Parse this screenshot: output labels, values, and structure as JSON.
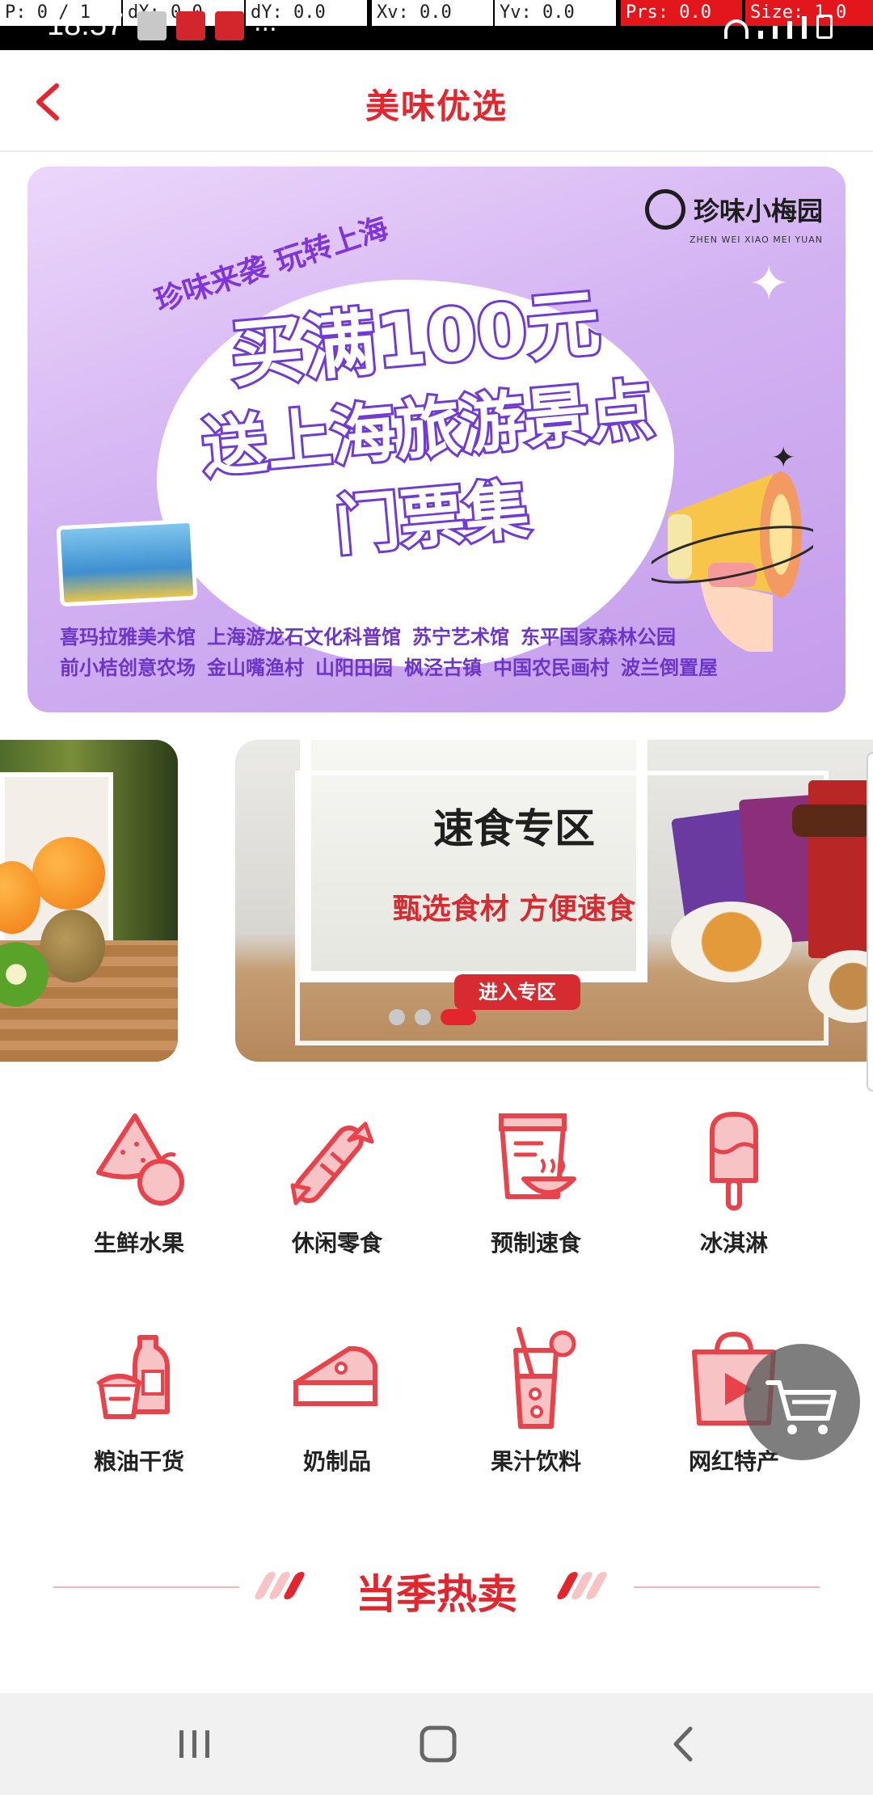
{
  "debug_bar": {
    "p": "P: 0 / 1",
    "dx": "dX: 0.0",
    "dy": "dY: 0.0",
    "xv": "Xv: 0.0",
    "yv": "Yv: 0.0",
    "prs": "Prs: 0.0",
    "size": "Size: 1.0"
  },
  "status_bar": {
    "time": "18:57",
    "overflow": "..."
  },
  "header": {
    "title": "美味优选",
    "back_icon": "chevron-left-icon"
  },
  "banner": {
    "tagline": "珍味来袭 玩转上海",
    "headline1": "买满100元",
    "headline2": "送上海旅游景点",
    "headline3": "门票集",
    "brand": "珍味小梅园",
    "brand_en": "ZHEN WEI XIAO MEI YUAN",
    "venues_row1": [
      "喜玛拉雅美术馆",
      "上海游龙石文化科普馆",
      "苏宁艺术馆",
      "东平国家森林公园"
    ],
    "venues_row2": [
      "前小桔创意农场",
      "金山嘴渔村",
      "山阳田园",
      "枫泾古镇",
      "中国农民画村",
      "波兰倒置屋"
    ]
  },
  "carousel": {
    "title": "速食专区",
    "subtitle": "甄选食材 方便速食",
    "button": "进入专区",
    "slide_count": 3,
    "active_index": 2
  },
  "categories": [
    {
      "label": "生鲜水果",
      "icon": "watermelon-icon"
    },
    {
      "label": "休闲零食",
      "icon": "candy-icon"
    },
    {
      "label": "预制速食",
      "icon": "instant-food-icon"
    },
    {
      "label": "冰淇淋",
      "icon": "ice-cream-icon"
    },
    {
      "label": "粮油干货",
      "icon": "grain-oil-icon"
    },
    {
      "label": "奶制品",
      "icon": "cheese-icon"
    },
    {
      "label": "果汁饮料",
      "icon": "juice-icon"
    },
    {
      "label": "网红特产",
      "icon": "shopping-bag-play-icon"
    }
  ],
  "floating_cart": {
    "icon": "cart-icon"
  },
  "section": {
    "title": "当季热卖"
  },
  "colors": {
    "accent": "#e3262d",
    "icon_line": "#e8424a",
    "icon_fill": "#f7c3c5",
    "banner_purple": "#6f3ad6"
  },
  "nav_bar": {
    "recents_icon": "recents-icon",
    "home_icon": "home-icon",
    "back_icon": "back-icon"
  }
}
